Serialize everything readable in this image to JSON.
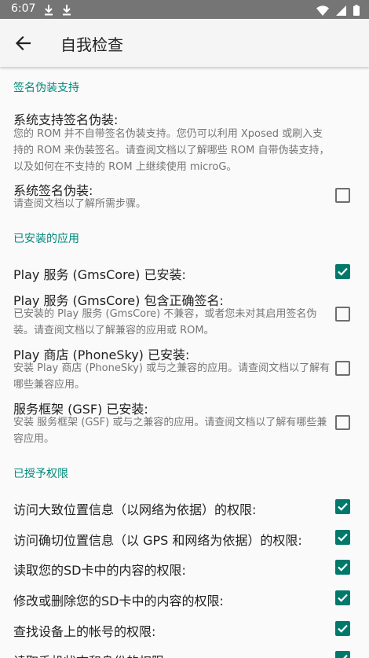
{
  "status_bar": {
    "time": "6:07"
  },
  "app_bar": {
    "title": "自我检查"
  },
  "sections": {
    "signature": {
      "title": "签名伪装支持",
      "items": [
        {
          "title": "系统支持签名伪装:",
          "summary": "您的 ROM 并不自带签名伪装支持。您仍可以利用 Xposed 或刷入支持的 ROM 来伪装签名。请查阅文档以了解哪些 ROM 自带伪装支持，以及如何在不支持的 ROM 上继续使用 microG。"
        },
        {
          "title": "系统签名伪装:",
          "summary": "请查阅文档以了解所需步骤。",
          "checked": false
        }
      ]
    },
    "installed": {
      "title": "已安装的应用",
      "items": [
        {
          "title": "Play 服务 (GmsCore) 已安装:",
          "checked": true
        },
        {
          "title": "Play 服务 (GmsCore) 包含正确签名:",
          "summary": "已安装的 Play 服务 (GmsCore) 不兼容，或者您未对其启用签名伪装。请查阅文档以了解兼容的应用或 ROM。",
          "checked": false
        },
        {
          "title": "Play 商店 (PhoneSky) 已安装:",
          "summary": "安装 Play 商店 (PhoneSky) 或与之兼容的应用。请查阅文档以了解有哪些兼容应用。",
          "checked": false
        },
        {
          "title": "服务框架 (GSF) 已安装:",
          "summary": "安装 服务框架 (GSF) 或与之兼容的应用。请查阅文档以了解有哪些兼容应用。",
          "checked": false
        }
      ]
    },
    "permissions": {
      "title": "已授予权限",
      "items": [
        {
          "title": "访问大致位置信息（以网络为依据）的权限:",
          "checked": true
        },
        {
          "title": "访问确切位置信息（以 GPS 和网络为依据）的权限:",
          "checked": true
        },
        {
          "title": "读取您的SD卡中的内容的权限:",
          "checked": true
        },
        {
          "title": "修改或删除您的SD卡中的内容的权限:",
          "checked": true
        },
        {
          "title": "查找设备上的帐号的权限:",
          "checked": true
        },
        {
          "title": "读取手机状态和身份的权限:",
          "checked": true
        }
      ]
    }
  },
  "colors": {
    "accent": "#00897b",
    "checkbox_on": "#00796b",
    "status_bar": "#757575",
    "app_bar": "#f5f5f5"
  }
}
